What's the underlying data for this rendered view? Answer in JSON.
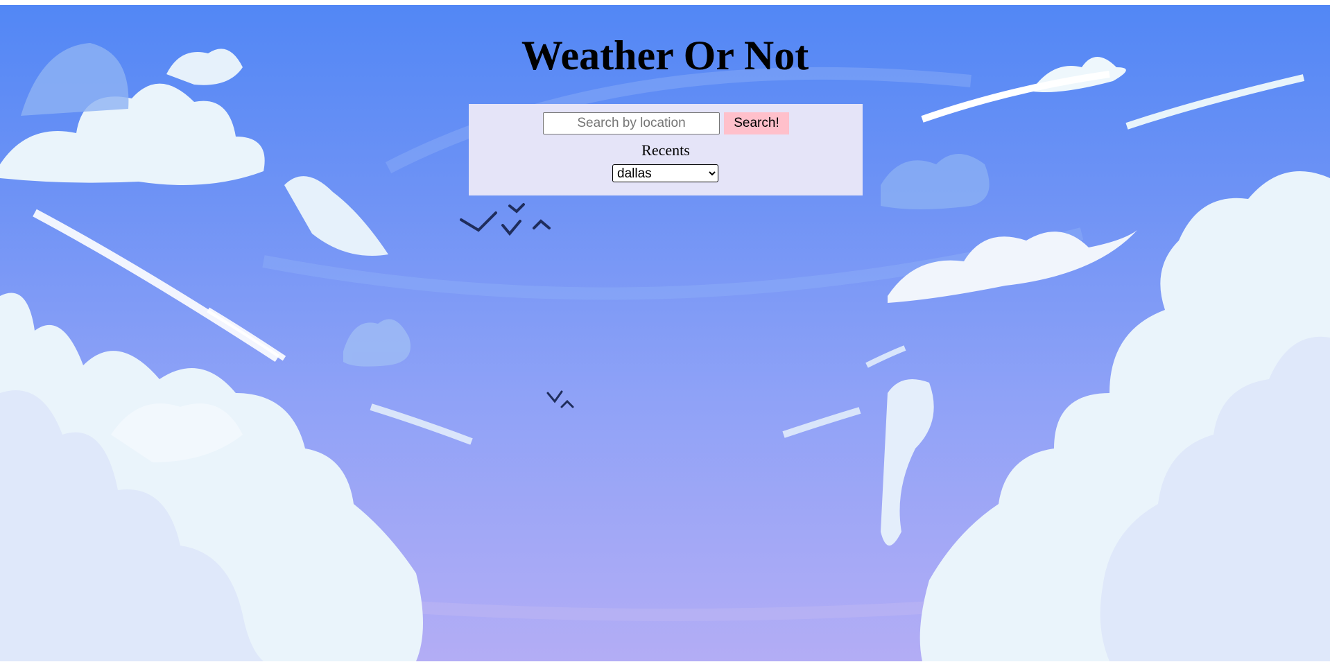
{
  "app": {
    "title": "Weather Or Not"
  },
  "search": {
    "placeholder": "Search by location",
    "value": "",
    "button_label": "Search!"
  },
  "recents": {
    "label": "Recents",
    "selected": "dallas",
    "options": [
      "dallas"
    ]
  },
  "colors": {
    "sky_top": "#5287f5",
    "sky_bottom": "#b3adf5",
    "panel_background": "#e5e4f8",
    "button_background": "#ffc0cb",
    "cloud": "#e8f4fb"
  }
}
